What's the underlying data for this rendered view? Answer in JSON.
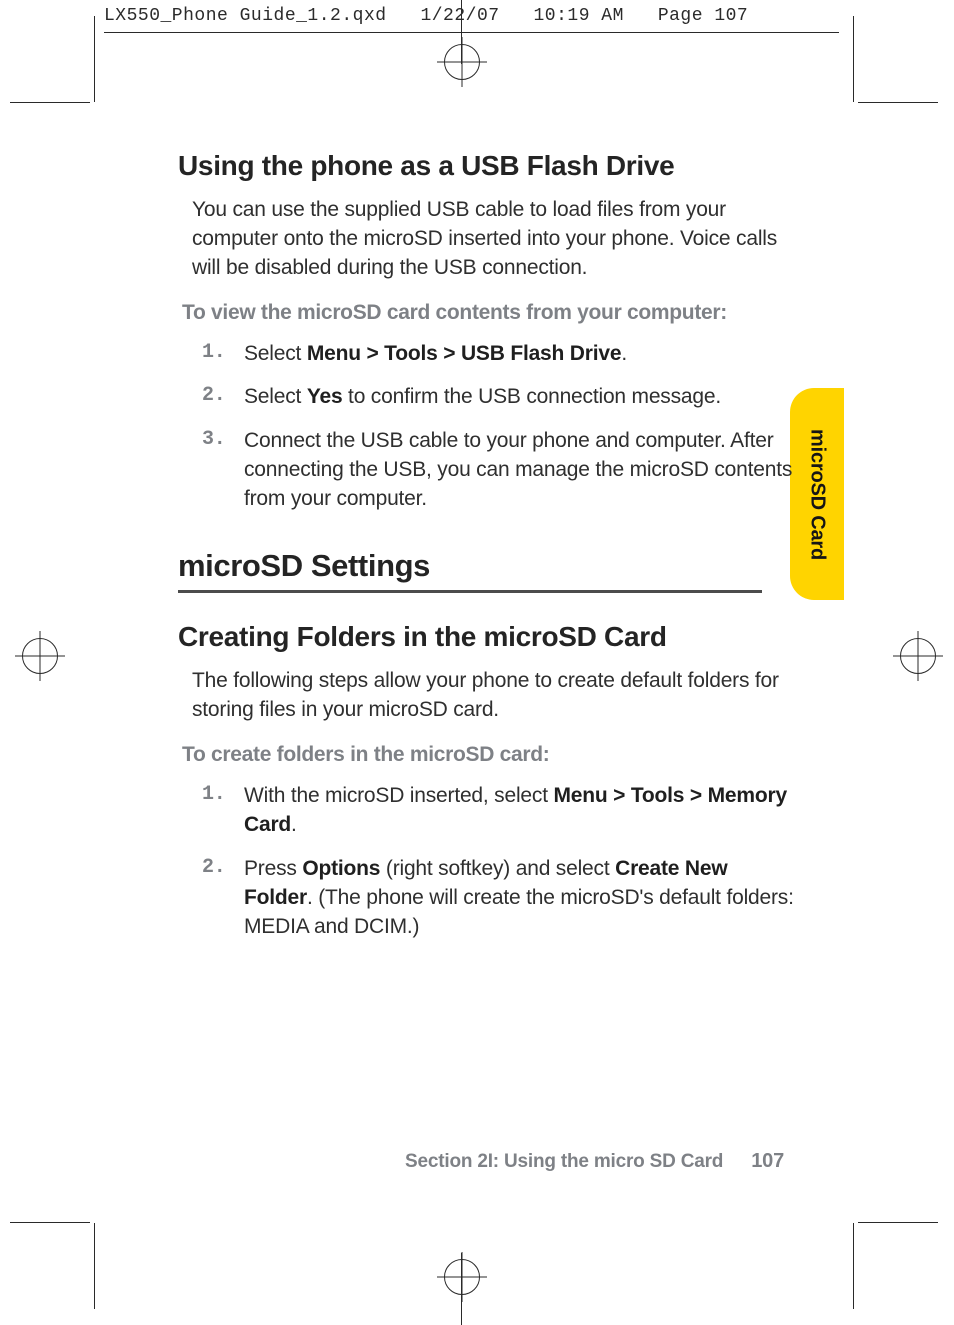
{
  "slug": {
    "filename": "LX550_Phone Guide_1.2.qxd",
    "date": "1/22/07",
    "time": "10:19 AM",
    "pagelabel": "Page 107"
  },
  "sideTab": "microSD Card",
  "h_usb": "Using the phone as a USB Flash Drive",
  "p_usb": "You can use the supplied USB cable to load files from your computer onto the microSD inserted into your phone.  Voice calls will be disabled during the USB connection.",
  "li_usb_lead": "To view the microSD card contents from your computer:",
  "steps_usb": [
    {
      "num": "1.",
      "pre": "Select ",
      "bold": "Menu > Tools > USB Flash Drive",
      "post": "."
    },
    {
      "num": "2.",
      "pre": "Select ",
      "bold": "Yes",
      "post": " to confirm the USB connection message."
    },
    {
      "num": "3.",
      "pre": "",
      "bold": "",
      "post": "Connect the USB cable to your phone and computer. After connecting the USB, you can manage the microSD contents from your computer."
    }
  ],
  "h_sect": "microSD Settings",
  "h_folders": "Creating Folders in the microSD Card",
  "p_folders": "The following steps allow your phone to create default folders for storing files in your microSD card.",
  "li_folders_lead": "To create folders in the microSD card:",
  "steps_folders": [
    {
      "num": "1.",
      "pre": "With the microSD inserted, select ",
      "bold": "Menu > Tools > Memory Card",
      "post": "."
    },
    {
      "num": "2.",
      "pre": "Press ",
      "bold": "Options",
      "mid": " (right softkey)  and select ",
      "bold2": "Create  New Folder",
      "post": ". (The phone will create the microSD's default folders: MEDIA and DCIM.)"
    }
  ],
  "runfoot": {
    "section": "Section 2I: Using the micro SD Card",
    "page": "107"
  }
}
